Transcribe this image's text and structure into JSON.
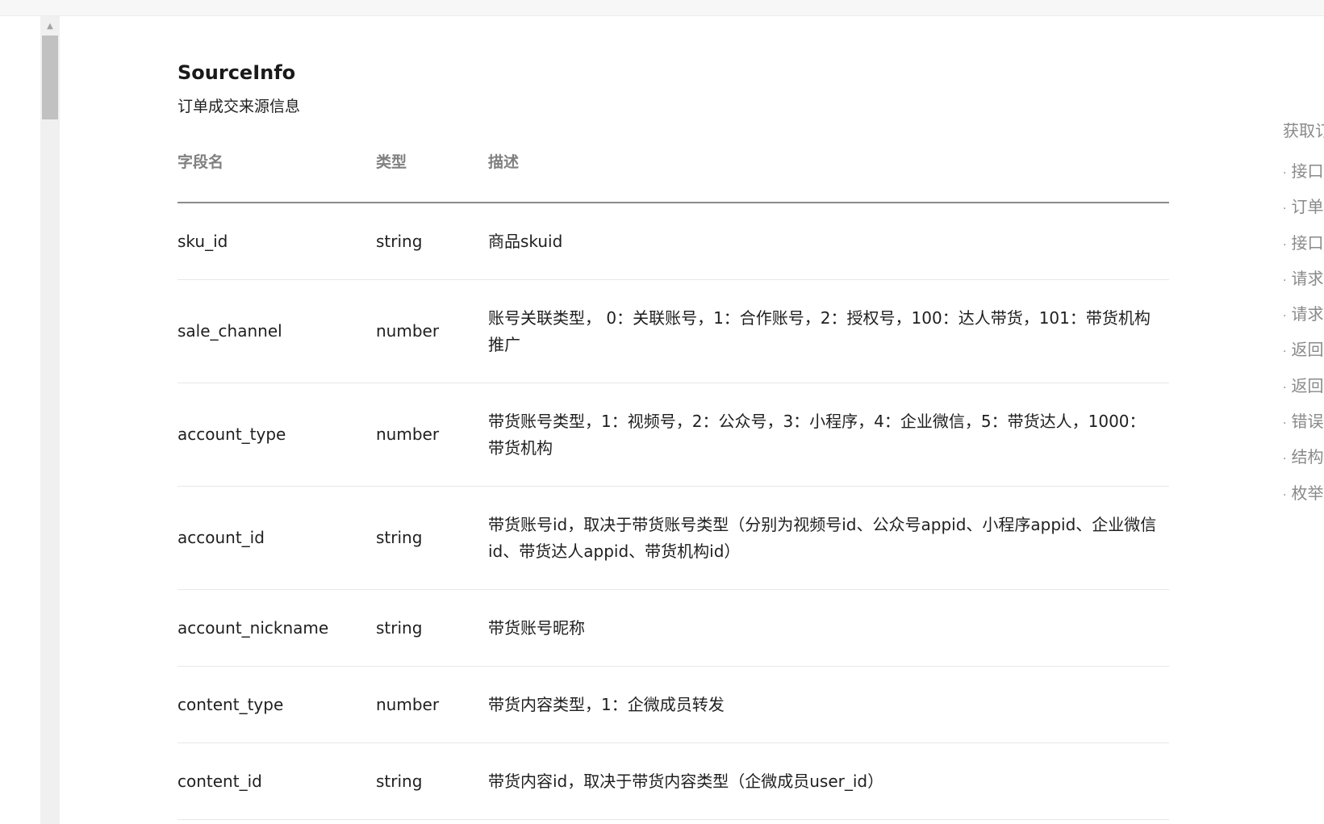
{
  "section": {
    "title": "SourceInfo",
    "subtitle": "订单成交来源信息"
  },
  "table": {
    "headers": [
      "字段名",
      "类型",
      "描述"
    ],
    "rows": [
      {
        "name": "sku_id",
        "type": "string",
        "desc": "商品skuid"
      },
      {
        "name": "sale_channel",
        "type": "number",
        "desc": "账号关联类型， 0：关联账号，1：合作账号，2：授权号，100：达人带货，101：带货机构推广"
      },
      {
        "name": "account_type",
        "type": "number",
        "desc": "带货账号类型，1：视频号，2：公众号，3：小程序，4：企业微信，5：带货达人，1000：带货机构"
      },
      {
        "name": "account_id",
        "type": "string",
        "desc": "带货账号id，取决于带货账号类型（分别为视频号id、公众号appid、小程序appid、企业微信id、带货达人appid、带货机构id）"
      },
      {
        "name": "account_nickname",
        "type": "string",
        "desc": "带货账号昵称"
      },
      {
        "name": "content_type",
        "type": "number",
        "desc": "带货内容类型，1：企微成员转发"
      },
      {
        "name": "content_id",
        "type": "string",
        "desc": "带货内容id，取决于带货内容类型（企微成员user_id）"
      }
    ]
  },
  "toc": {
    "heading": "获取订",
    "items": [
      "接口",
      "订单",
      "接口",
      "请求",
      "请求",
      "返回",
      "返回",
      "错误",
      "结构",
      "枚举"
    ]
  },
  "icons": {
    "scroll_up": "chevron-up-icon"
  }
}
